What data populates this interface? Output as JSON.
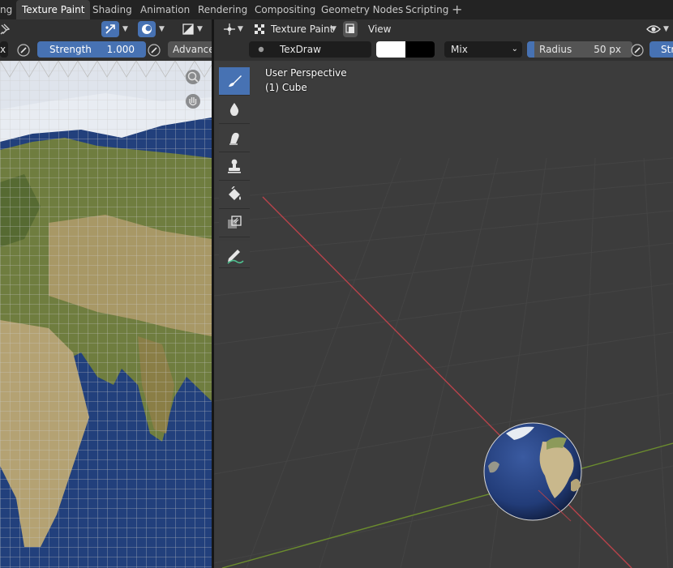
{
  "workspace_tabs": [
    {
      "label": "ng",
      "active": false
    },
    {
      "label": "Texture Paint",
      "active": true
    },
    {
      "label": "Shading",
      "active": false
    },
    {
      "label": "Animation",
      "active": false
    },
    {
      "label": "Rendering",
      "active": false
    },
    {
      "label": "Compositing",
      "active": false
    },
    {
      "label": "Geometry Nodes",
      "active": false
    },
    {
      "label": "Scripting",
      "active": false
    }
  ],
  "workspace_add": "+",
  "uv_editor": {
    "tool_header": {
      "left_field": "x",
      "strength_label": "Strength",
      "strength_value": "1.000",
      "advanced_label": "Advanced"
    }
  },
  "viewport": {
    "header": {
      "mode_label": "Texture Paint",
      "view_menu": "View"
    },
    "tool_header": {
      "brush_name": "TexDraw",
      "blend_mode": "Mix",
      "radius_label": "Radius",
      "radius_value": "50 px",
      "strength_stub": "Str"
    },
    "overlay": {
      "perspective": "User Perspective",
      "object": "(1) Cube"
    },
    "tools": [
      {
        "name": "draw",
        "active": true
      },
      {
        "name": "soften",
        "active": false
      },
      {
        "name": "smear",
        "active": false
      },
      {
        "name": "clone",
        "active": false
      },
      {
        "name": "fill",
        "active": false
      },
      {
        "name": "mask",
        "active": false
      },
      {
        "name": "annotate",
        "active": false
      }
    ]
  },
  "colors": {
    "accent": "#4772b3",
    "primary_color": "#ffffff",
    "secondary_color": "#000000",
    "x_axis": "#b8434b",
    "y_axis": "#6b8c2e"
  }
}
